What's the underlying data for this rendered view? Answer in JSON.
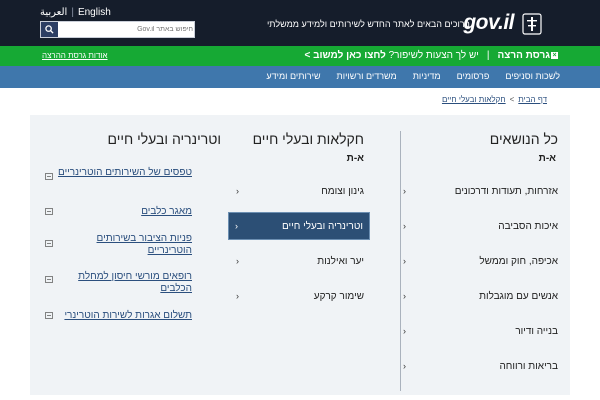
{
  "header": {
    "lang_arabic": "العربية",
    "lang_english": "English",
    "search_placeholder": "חיפוש באתר Gov.il",
    "tagline": "ברוכים הבאים לאתר החדש לשירותים ולמידע ממשלתי",
    "logo": "gov.il"
  },
  "beta_bar": {
    "title": "גרסת הרצה",
    "question": "יש לך הצעות לשיפור?",
    "cta": "לחצו כאן למשוב >",
    "about": "אודות גרסת ההרצה"
  },
  "nav": {
    "items": [
      "שירותים ומידע",
      "משרדים ורשויות",
      "מדיניות",
      "פרסומים",
      "לשכות וסניפים"
    ]
  },
  "breadcrumb": {
    "home": "דף הבית",
    "current": "חקלאות ובעלי חיים"
  },
  "columns": {
    "all_topics": {
      "title": "כל הנושאים",
      "sub": "א-ת",
      "items": [
        "אזרחות, תעודות ודרכונים",
        "איכות הסביבה",
        "אכיפה, חוק וממשל",
        "אנשים עם מוגבלות",
        "בנייה ודיור",
        "בריאות ורווחה"
      ]
    },
    "agriculture": {
      "title": "חקלאות ובעלי חיים",
      "sub": "א-ת",
      "items": [
        "גינון וצומח",
        "וטרינריה ובעלי חיים",
        "יער ואילנות",
        "שימור קרקע"
      ],
      "active_index": 1
    },
    "veterinary": {
      "title": "וטרינריה ובעלי חיים",
      "items": [
        "טפסים של השירותים הוטרינריים",
        "מאגר כלבים",
        "פניות הציבור בשירותים הוטרינריים",
        "רופאים מורשי חיסון למחלת הכלבים",
        "תשלום אגרות לשירות הוטרינרי"
      ]
    }
  },
  "icons": {
    "search": "search-icon",
    "emblem": "state-emblem-icon",
    "close": "close-icon",
    "arrow": "chevron-left-icon",
    "service": "service-link-icon"
  },
  "colors": {
    "topbar": "#151d2b",
    "beta_green": "#16a934",
    "nav_blue": "#3f77ac",
    "active_item": "#2c4f75",
    "content_bg": "#f0f3f6"
  }
}
